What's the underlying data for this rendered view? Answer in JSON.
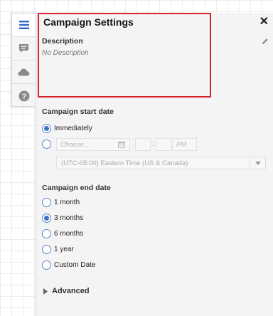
{
  "panel": {
    "title": "Campaign Settings",
    "close_glyph": "✕",
    "edit_icon": "pencil-icon"
  },
  "rail": {
    "items": [
      {
        "icon": "list-icon",
        "active": true
      },
      {
        "icon": "comment-icon",
        "active": false
      },
      {
        "icon": "cloud-icon",
        "active": false
      },
      {
        "icon": "help-icon",
        "active": false
      }
    ]
  },
  "description": {
    "label": "Description",
    "value": "No Description"
  },
  "start": {
    "label": "Campaign start date",
    "immediately_label": "Immediately",
    "selected": "Immediately",
    "date_placeholder": "Choose...",
    "time_colon": ":",
    "ampm_placeholder": "PM",
    "timezone": "(UTC-05:00) Eastern Time (US & Canada)"
  },
  "end": {
    "label": "Campaign end date",
    "options": [
      "1 month",
      "3 months",
      "6 months",
      "1 year",
      "Custom Date"
    ],
    "selected": "3 months"
  },
  "advanced": {
    "label": "Advanced"
  },
  "colors": {
    "accent": "#3c73c6",
    "highlight": "#d3232f",
    "rail_active_icon": "#2f68c4",
    "rail_icon": "#8a8a8a"
  }
}
